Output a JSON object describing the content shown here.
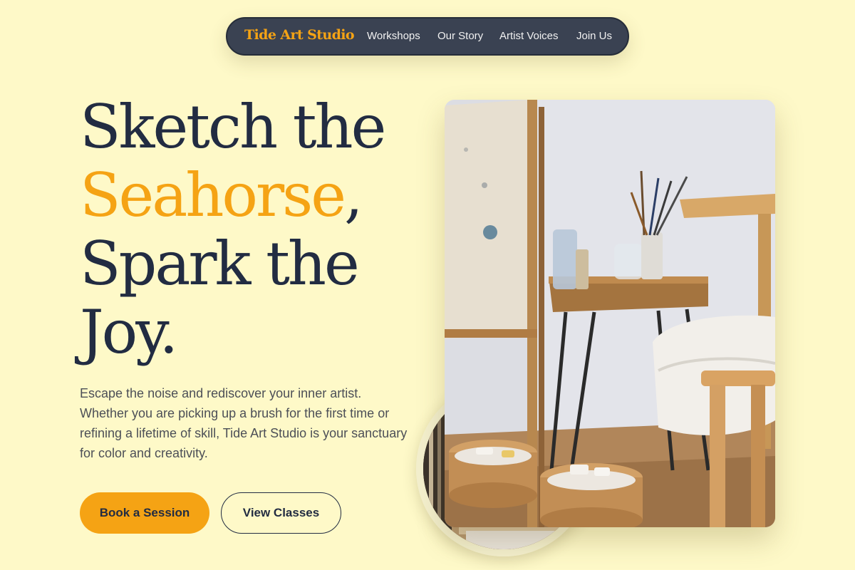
{
  "nav": {
    "brand": "Tide Art Studio",
    "links": [
      "Workshops",
      "Our Story",
      "Artist Voices",
      "Join Us"
    ]
  },
  "hero": {
    "headline": {
      "line1": "Sketch the",
      "line2_accent": "Seahorse",
      "line2_rest": ",",
      "line3": "Spark the",
      "line4": "Joy."
    },
    "description": "Escape the noise and rediscover your inner artist. Whether you are picking up a brush for the first time or refining a lifetime of skill, Tide Art Studio is your sanctuary for color and creativity.",
    "primary_button": "Book a Session",
    "secondary_button": "View Classes"
  },
  "colors": {
    "background": "#fef9c8",
    "accent": "#f5a314",
    "ink": "#222c42",
    "nav_bg": "#3a4252"
  },
  "icons": {
    "studio_photo": "art-studio-photo",
    "circle_photo": "paint-supplies-photo"
  }
}
